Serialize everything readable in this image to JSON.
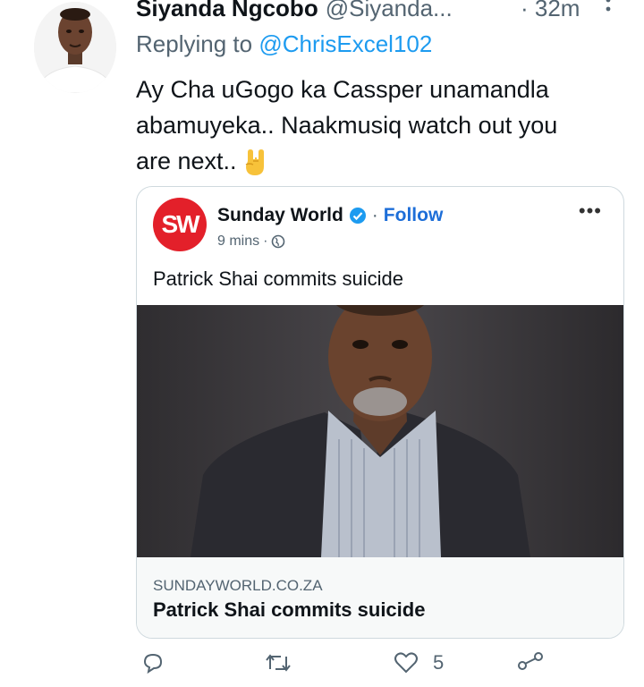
{
  "tweet": {
    "author_name": "Siyanda Ngcobo",
    "author_handle": "@Siyanda...",
    "time_label": "· 32m",
    "replying_prefix": "Replying to ",
    "replying_to": "@ChrisExcel102",
    "body_line1": "Ay Cha uGogo ka Cassper unamandla",
    "body_line2": "abamuyeka.. Naakmusiq watch out you",
    "body_line3": "are next..",
    "emoji": "rock-hand-emoji"
  },
  "card": {
    "logo_text": "SW",
    "account_name": "Sunday World",
    "separator": "·",
    "follow_label": "Follow",
    "age": "9 mins",
    "meta_separator": "·",
    "post_text": "Patrick Shai commits suicide",
    "link_domain": "SUNDAYWORLD.CO.ZA",
    "link_title": "Patrick Shai commits suicide",
    "accent_color": "#e3202a",
    "follow_color": "#1d6ed8"
  },
  "actions": {
    "like_count": "5"
  },
  "icons": [
    "more-vertical-icon",
    "verified-badge-icon",
    "globe-icon",
    "more-horizontal-icon",
    "reply-icon",
    "retweet-icon",
    "like-icon",
    "share-icon"
  ]
}
